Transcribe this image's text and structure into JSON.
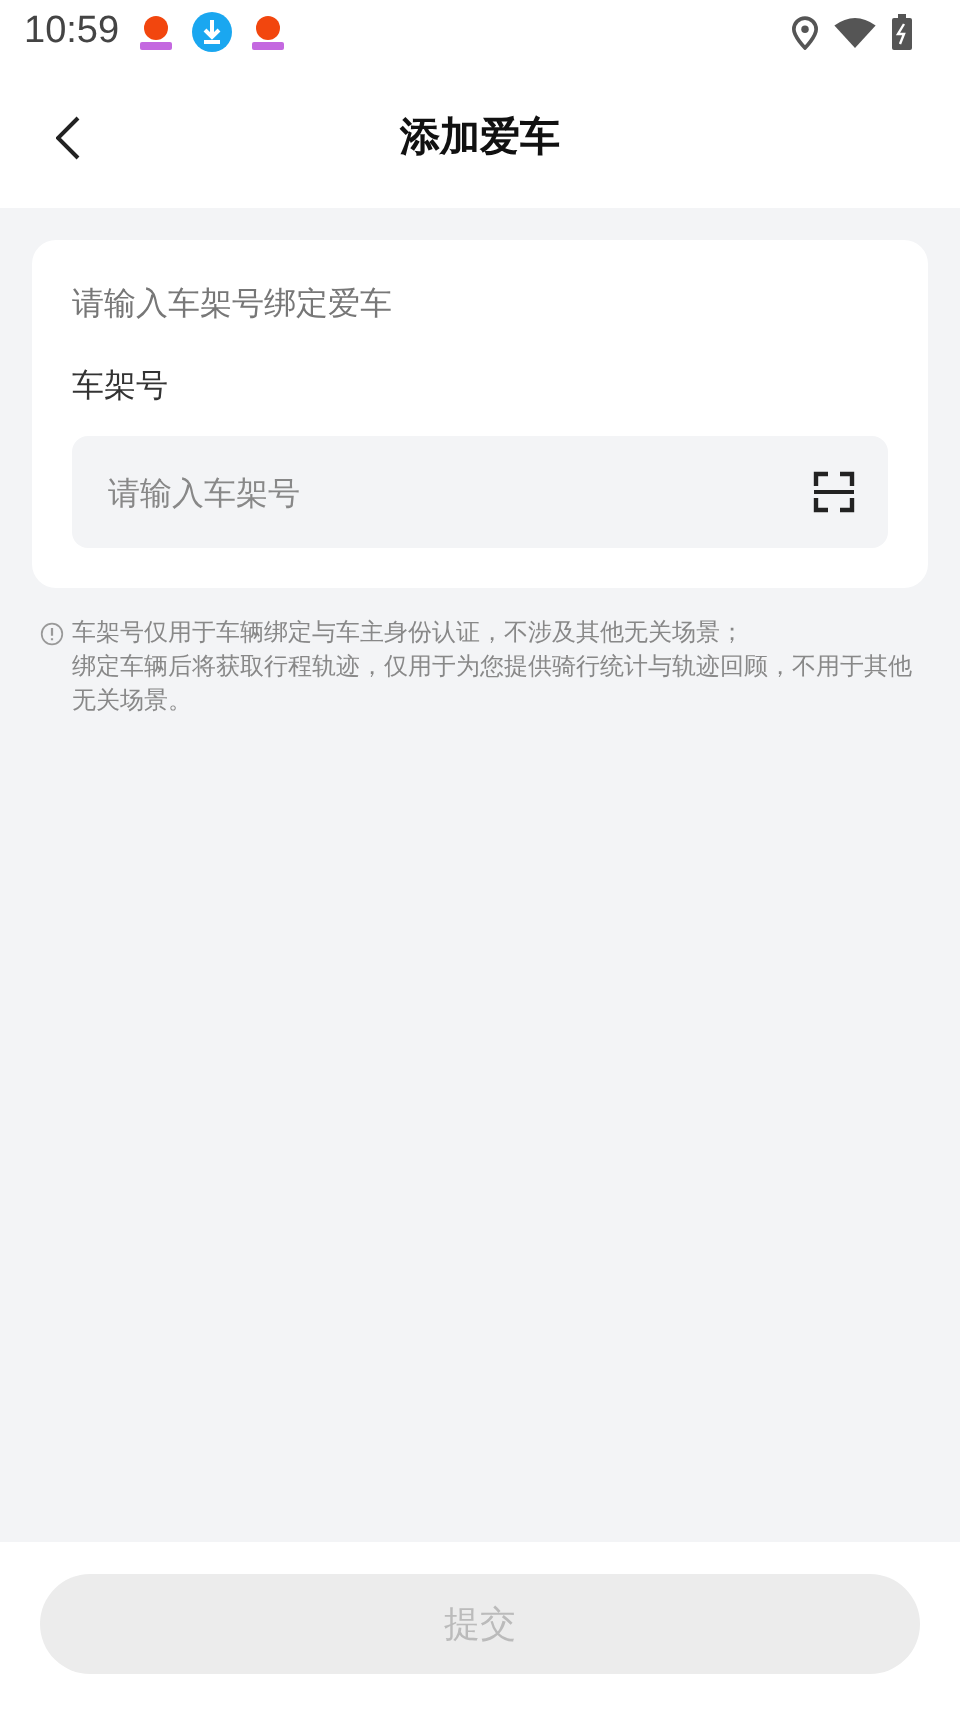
{
  "status_bar": {
    "time": "10:59"
  },
  "header": {
    "title": "添加爱车"
  },
  "card": {
    "heading": "请输入车架号绑定爱车",
    "field_label": "车架号",
    "field": {
      "placeholder": "请输入车架号"
    }
  },
  "notice": [
    "车架号仅用于车辆绑定与车主身份认证，不涉及其他无关场景；",
    "绑定车辆后将获取行程轨迹，仅用于为您提供骑行统计与轨迹回顾，不用于其他无关场景。"
  ],
  "submit": {
    "label": "提交",
    "disabled": true
  }
}
